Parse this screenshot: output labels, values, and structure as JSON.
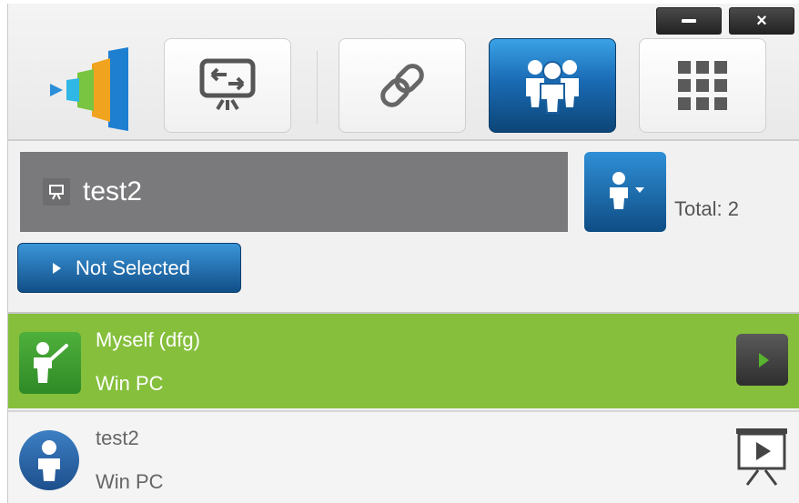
{
  "window_controls": {
    "minimize": "minimize",
    "close": "×"
  },
  "toolbar": {
    "buttons": [
      {
        "name": "screen-switch",
        "icon": "screen-swap-icon",
        "active": false
      },
      {
        "name": "link",
        "icon": "link-icon",
        "active": false
      },
      {
        "name": "participants",
        "icon": "group-icon",
        "active": true
      },
      {
        "name": "apps",
        "icon": "grid-icon",
        "active": false
      }
    ]
  },
  "room": {
    "name": "test2",
    "icon": "projector-icon"
  },
  "participants_menu": {
    "icon": "person-dropdown-icon",
    "total_label": "Total: 2"
  },
  "selection_button": {
    "label": "Not Selected"
  },
  "participants": [
    {
      "name": "Myself (dfg)",
      "device": "Win PC",
      "role": "presenter",
      "highlighted": true,
      "action": "play-icon"
    },
    {
      "name": "test2",
      "device": "Win PC",
      "role": "viewer",
      "highlighted": false,
      "action": "present-screen-icon"
    }
  ],
  "colors": {
    "accent_blue": "#1a6bb4",
    "highlight_green": "#85bf3c",
    "room_bar": "#7a7a7c"
  }
}
